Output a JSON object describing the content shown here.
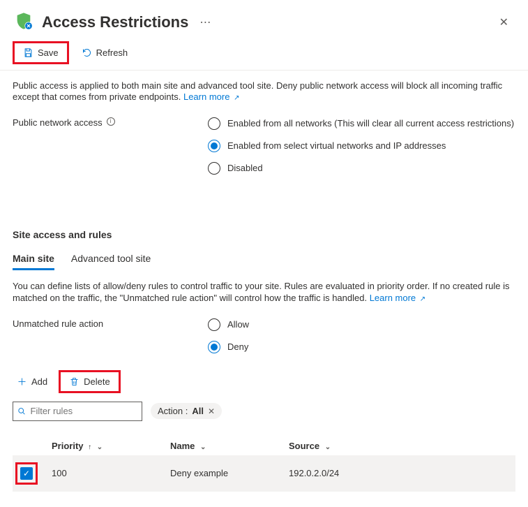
{
  "header": {
    "title": "Access Restrictions"
  },
  "toolbar": {
    "save_label": "Save",
    "refresh_label": "Refresh"
  },
  "description": {
    "text": "Public access is applied to both main site and advanced tool site. Deny public network access will block all incoming traffic except that comes from private endpoints. ",
    "learn_more": "Learn more"
  },
  "public_access": {
    "label": "Public network access",
    "options": [
      {
        "label": "Enabled from all networks (This will clear all current access restrictions)",
        "selected": false
      },
      {
        "label": "Enabled from select virtual networks and IP addresses",
        "selected": true
      },
      {
        "label": "Disabled",
        "selected": false
      }
    ]
  },
  "section2": {
    "title": "Site access and rules",
    "tabs": [
      {
        "label": "Main site",
        "active": true
      },
      {
        "label": "Advanced tool site",
        "active": false
      }
    ],
    "desc": "You can define lists of allow/deny rules to control traffic to your site. Rules are evaluated in priority order. If no created rule is matched on the traffic, the \"Unmatched rule action\" will control how the traffic is handled. ",
    "learn_more": "Learn more"
  },
  "unmatched": {
    "label": "Unmatched rule action",
    "options": [
      {
        "label": "Allow",
        "selected": false
      },
      {
        "label": "Deny",
        "selected": true
      }
    ]
  },
  "table_toolbar": {
    "add_label": "Add",
    "delete_label": "Delete"
  },
  "filter": {
    "placeholder": "Filter rules",
    "pill_key": "Action : ",
    "pill_value": "All"
  },
  "grid": {
    "columns": {
      "priority": "Priority",
      "name": "Name",
      "source": "Source"
    },
    "rows": [
      {
        "selected": true,
        "priority": "100",
        "name": "Deny example",
        "source": "192.0.2.0/24"
      }
    ]
  }
}
